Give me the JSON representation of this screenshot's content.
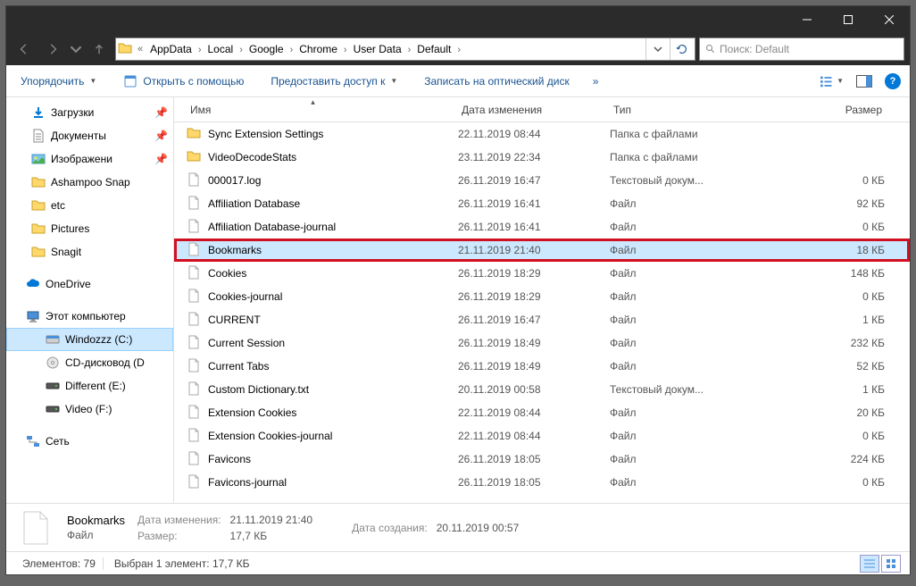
{
  "titlebar": {
    "title": ""
  },
  "nav": {
    "path_segments": [
      "AppData",
      "Local",
      "Google",
      "Chrome",
      "User Data",
      "Default"
    ]
  },
  "search": {
    "placeholder": "Поиск: Default"
  },
  "toolbar": {
    "organize": "Упорядочить",
    "open_with": "Открыть с помощью",
    "share": "Предоставить доступ к",
    "burn": "Записать на оптический диск"
  },
  "columns": {
    "name": "Имя",
    "date": "Дата изменения",
    "type": "Тип",
    "size": "Размер"
  },
  "sidebar": {
    "downloads": "Загрузки",
    "documents": "Документы",
    "images": "Изображени",
    "ashampoo": "Ashampoo Snap",
    "etc": "etc",
    "pictures": "Pictures",
    "snagit": "Snagit",
    "onedrive": "OneDrive",
    "this_pc": "Этот компьютер",
    "windozzz": "Windozzz (C:)",
    "cd": "CD-дисковод (D",
    "different": "Different (E:)",
    "video": "Video (F:)",
    "network": "Сеть"
  },
  "types": {
    "folder": "Папка с файлами",
    "text": "Текстовый докум...",
    "file": "Файл"
  },
  "files": [
    {
      "name": "Sync Extension Settings",
      "date": "22.11.2019 08:44",
      "type": "folder",
      "size": ""
    },
    {
      "name": "VideoDecodeStats",
      "date": "23.11.2019 22:34",
      "type": "folder",
      "size": ""
    },
    {
      "name": "000017.log",
      "date": "26.11.2019 16:47",
      "type": "text",
      "size": "0 КБ"
    },
    {
      "name": "Affiliation Database",
      "date": "26.11.2019 16:41",
      "type": "file",
      "size": "92 КБ"
    },
    {
      "name": "Affiliation Database-journal",
      "date": "26.11.2019 16:41",
      "type": "file",
      "size": "0 КБ"
    },
    {
      "name": "Bookmarks",
      "date": "21.11.2019 21:40",
      "type": "file",
      "size": "18 КБ",
      "selected": true,
      "highlighted": true
    },
    {
      "name": "Cookies",
      "date": "26.11.2019 18:29",
      "type": "file",
      "size": "148 КБ"
    },
    {
      "name": "Cookies-journal",
      "date": "26.11.2019 18:29",
      "type": "file",
      "size": "0 КБ"
    },
    {
      "name": "CURRENT",
      "date": "26.11.2019 16:47",
      "type": "file",
      "size": "1 КБ"
    },
    {
      "name": "Current Session",
      "date": "26.11.2019 18:49",
      "type": "file",
      "size": "232 КБ"
    },
    {
      "name": "Current Tabs",
      "date": "26.11.2019 18:49",
      "type": "file",
      "size": "52 КБ"
    },
    {
      "name": "Custom Dictionary.txt",
      "date": "20.11.2019 00:58",
      "type": "text",
      "size": "1 КБ"
    },
    {
      "name": "Extension Cookies",
      "date": "22.11.2019 08:44",
      "type": "file",
      "size": "20 КБ"
    },
    {
      "name": "Extension Cookies-journal",
      "date": "22.11.2019 08:44",
      "type": "file",
      "size": "0 КБ"
    },
    {
      "name": "Favicons",
      "date": "26.11.2019 18:05",
      "type": "file",
      "size": "224 КБ"
    },
    {
      "name": "Favicons-journal",
      "date": "26.11.2019 18:05",
      "type": "file",
      "size": "0 КБ"
    }
  ],
  "details": {
    "name": "Bookmarks",
    "type": "Файл",
    "mod_label": "Дата изменения:",
    "mod_value": "21.11.2019 21:40",
    "size_label": "Размер:",
    "size_value": "17,7 КБ",
    "created_label": "Дата создания:",
    "created_value": "20.11.2019 00:57"
  },
  "status": {
    "elements": "Элементов: 79",
    "selected": "Выбран 1 элемент: 17,7 КБ"
  }
}
